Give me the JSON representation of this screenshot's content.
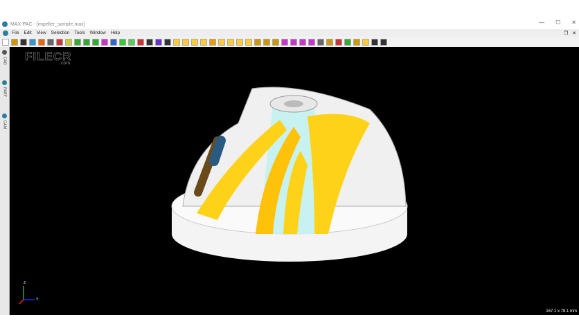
{
  "window": {
    "title": "MAX-PAC - [impeller_sample.max]",
    "min": "—",
    "max": "☐",
    "close": "✕"
  },
  "menu": [
    "File",
    "Edit",
    "View",
    "Selection",
    "Tools",
    "Window",
    "Help"
  ],
  "mdi": {
    "restore": "❐",
    "close": "✕"
  },
  "sidebar": [
    {
      "label": "CAD"
    },
    {
      "label": "PART"
    },
    {
      "label": "CAM"
    }
  ],
  "watermark": {
    "text": "FILECR",
    "sub": ".com"
  },
  "status": {
    "dimensions": "167.1 x 78.1 mm"
  },
  "axes": {
    "z": "Z",
    "y": "Y"
  },
  "colors": {
    "accent": "#2a7f9e",
    "blade": "#ffd21a",
    "hub": "#c8f2f2"
  }
}
